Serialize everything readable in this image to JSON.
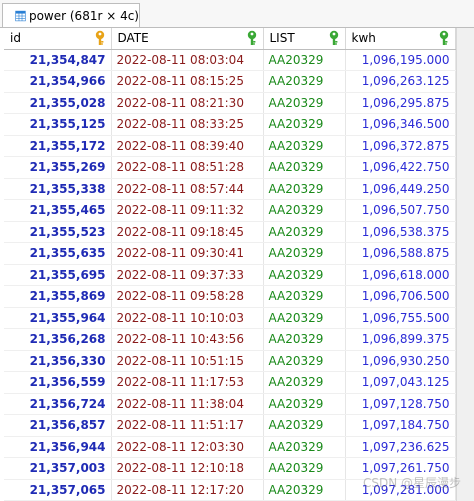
{
  "tab": {
    "label": "power (681r × 4c)",
    "icon": "table-grid-icon"
  },
  "columns": [
    {
      "label": "id",
      "key_color": "#e8a317"
    },
    {
      "label": "DATE",
      "key_color": "#3aa835"
    },
    {
      "label": "LIST",
      "key_color": "#3aa835"
    },
    {
      "label": "kwh",
      "key_color": "#3aa835"
    }
  ],
  "rows": [
    [
      "21,354,847",
      "2022-08-11 08:03:04",
      "AA20329",
      "1,096,195.000"
    ],
    [
      "21,354,966",
      "2022-08-11 08:15:25",
      "AA20329",
      "1,096,263.125"
    ],
    [
      "21,355,028",
      "2022-08-11 08:21:30",
      "AA20329",
      "1,096,295.875"
    ],
    [
      "21,355,125",
      "2022-08-11 08:33:25",
      "AA20329",
      "1,096,346.500"
    ],
    [
      "21,355,172",
      "2022-08-11 08:39:40",
      "AA20329",
      "1,096,372.875"
    ],
    [
      "21,355,269",
      "2022-08-11 08:51:28",
      "AA20329",
      "1,096,422.750"
    ],
    [
      "21,355,338",
      "2022-08-11 08:57:44",
      "AA20329",
      "1,096,449.250"
    ],
    [
      "21,355,465",
      "2022-08-11 09:11:32",
      "AA20329",
      "1,096,507.750"
    ],
    [
      "21,355,523",
      "2022-08-11 09:18:45",
      "AA20329",
      "1,096,538.375"
    ],
    [
      "21,355,635",
      "2022-08-11 09:30:41",
      "AA20329",
      "1,096,588.875"
    ],
    [
      "21,355,695",
      "2022-08-11 09:37:33",
      "AA20329",
      "1,096,618.000"
    ],
    [
      "21,355,869",
      "2022-08-11 09:58:28",
      "AA20329",
      "1,096,706.500"
    ],
    [
      "21,355,964",
      "2022-08-11 10:10:03",
      "AA20329",
      "1,096,755.500"
    ],
    [
      "21,356,268",
      "2022-08-11 10:43:56",
      "AA20329",
      "1,096,899.375"
    ],
    [
      "21,356,330",
      "2022-08-11 10:51:15",
      "AA20329",
      "1,096,930.250"
    ],
    [
      "21,356,559",
      "2022-08-11 11:17:53",
      "AA20329",
      "1,097,043.125"
    ],
    [
      "21,356,724",
      "2022-08-11 11:38:04",
      "AA20329",
      "1,097,128.750"
    ],
    [
      "21,356,857",
      "2022-08-11 11:51:17",
      "AA20329",
      "1,097,184.750"
    ],
    [
      "21,356,944",
      "2022-08-11 12:03:30",
      "AA20329",
      "1,097,236.625"
    ],
    [
      "21,357,003",
      "2022-08-11 12:10:18",
      "AA20329",
      "1,097,261.750"
    ],
    [
      "21,357,065",
      "2022-08-11 12:17:20",
      "AA20329",
      "1,097,281.000"
    ]
  ],
  "watermark": "CSDN @星辰漫步"
}
